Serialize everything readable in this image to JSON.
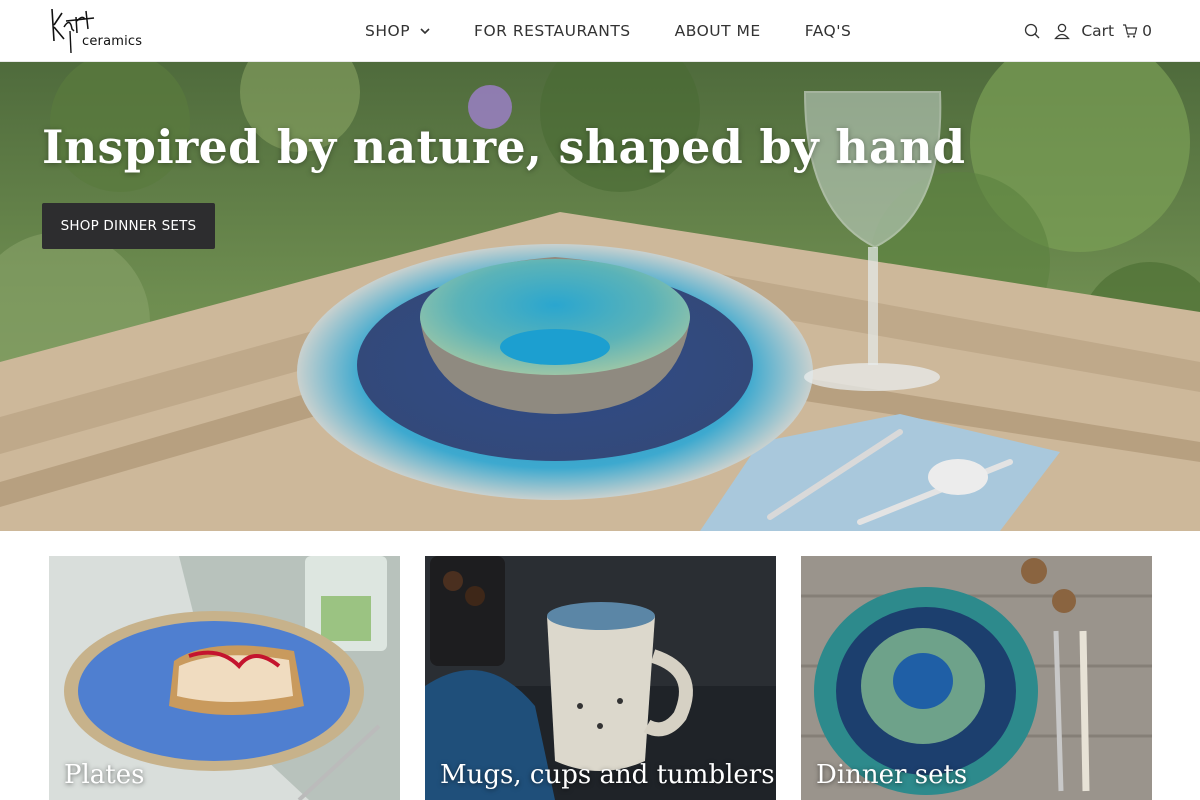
{
  "brand": {
    "logo_script": "Kari",
    "logo_word": "ceramics"
  },
  "nav": {
    "items": [
      {
        "label": "SHOP",
        "has_dropdown": true
      },
      {
        "label": "FOR RESTAURANTS",
        "has_dropdown": false
      },
      {
        "label": "ABOUT ME",
        "has_dropdown": false
      },
      {
        "label": "FAQ'S",
        "has_dropdown": false
      }
    ]
  },
  "utilities": {
    "search_icon": "search-icon",
    "account_icon": "user-icon",
    "cart_label": "Cart",
    "cart_icon": "shopping-cart-icon",
    "cart_count": "0"
  },
  "hero": {
    "title": "Inspired by nature, shaped by hand",
    "button_label": "SHOP DINNER SETS"
  },
  "collections": [
    {
      "title": "Plates"
    },
    {
      "title": "Mugs, cups and tumblers"
    },
    {
      "title": "Dinner sets"
    }
  ],
  "colors": {
    "button_bg": "#2d2d2f",
    "text": "#333333",
    "accent_blue": "#3fa7c9"
  }
}
